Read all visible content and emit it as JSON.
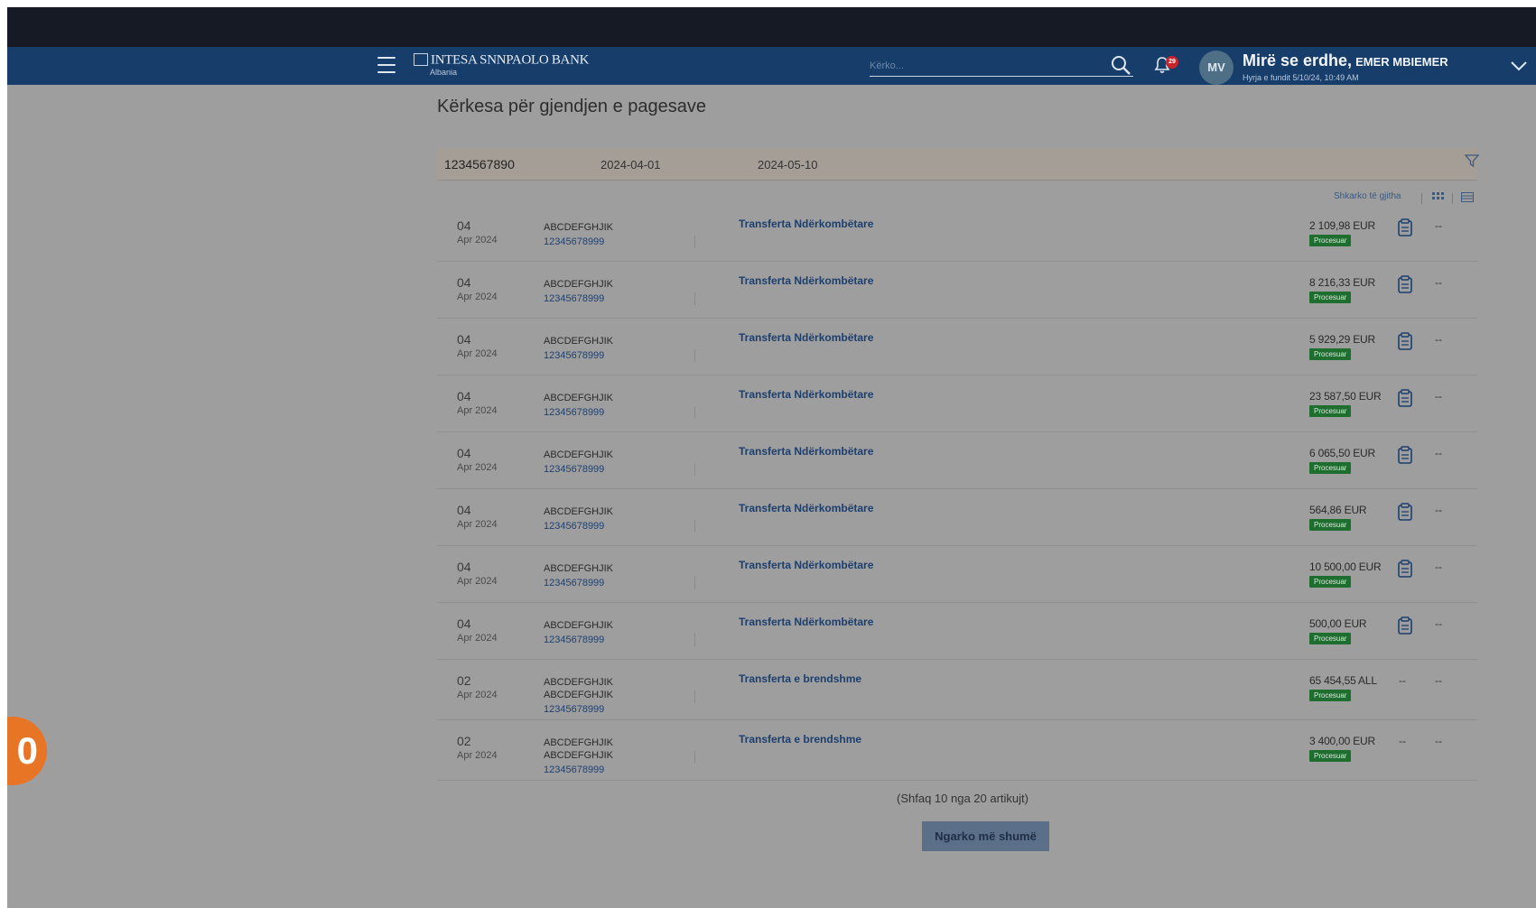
{
  "brand": {
    "name": "INTESA SNNPAOLO BANK",
    "country": "Albania"
  },
  "search": {
    "placeholder": "Kërko..."
  },
  "notifications": {
    "count": "29"
  },
  "user": {
    "initials": "MV",
    "greeting": "Mirë se erdhe,",
    "name": "EMER MBIEMER",
    "last_login": "Hyrja e fundit 5/10/24, 10:49 AM"
  },
  "page": {
    "title": "Kërkesa për gjendjen e pagesave",
    "download_all": "Shkarko të gjitha",
    "pager_info": "(Shfaq 10 nga 20 artikujt)",
    "load_more": "Ngarko më shumë"
  },
  "filter": {
    "account": "1234567890",
    "date_from": "2024-04-01",
    "date_to": "2024-05-10"
  },
  "side_badge": "0",
  "colors": {
    "navbar": "#173d6b",
    "status": "#1d6e2f",
    "badge": "#e87426"
  },
  "payments": [
    {
      "day": "04",
      "month": "Apr 2024",
      "names": [
        "ABCDEFGHJIK"
      ],
      "account": "12345678999",
      "type": "Transferta Ndërkombëtare",
      "amount": "2 109,98 EUR",
      "status": "Procesuar",
      "has_doc": true
    },
    {
      "day": "04",
      "month": "Apr 2024",
      "names": [
        "ABCDEFGHJIK"
      ],
      "account": "12345678999",
      "type": "Transferta Ndërkombëtare",
      "amount": "8 216,33 EUR",
      "status": "Procesuar",
      "has_doc": true
    },
    {
      "day": "04",
      "month": "Apr 2024",
      "names": [
        "ABCDEFGHJIK"
      ],
      "account": "12345678999",
      "type": "Transferta Ndërkombëtare",
      "amount": "5 929,29 EUR",
      "status": "Procesuar",
      "has_doc": true
    },
    {
      "day": "04",
      "month": "Apr 2024",
      "names": [
        "ABCDEFGHJIK"
      ],
      "account": "12345678999",
      "type": "Transferta Ndërkombëtare",
      "amount": "23 587,50 EUR",
      "status": "Procesuar",
      "has_doc": true
    },
    {
      "day": "04",
      "month": "Apr 2024",
      "names": [
        "ABCDEFGHJIK"
      ],
      "account": "12345678999",
      "type": "Transferta Ndërkombëtare",
      "amount": "6 065,50 EUR",
      "status": "Procesuar",
      "has_doc": true
    },
    {
      "day": "04",
      "month": "Apr 2024",
      "names": [
        "ABCDEFGHJIK"
      ],
      "account": "12345678999",
      "type": "Transferta Ndërkombëtare",
      "amount": "564,86 EUR",
      "status": "Procesuar",
      "has_doc": true
    },
    {
      "day": "04",
      "month": "Apr 2024",
      "names": [
        "ABCDEFGHJIK"
      ],
      "account": "12345678999",
      "type": "Transferta Ndërkombëtare",
      "amount": "10 500,00 EUR",
      "status": "Procesuar",
      "has_doc": true
    },
    {
      "day": "04",
      "month": "Apr 2024",
      "names": [
        "ABCDEFGHJIK"
      ],
      "account": "12345678999",
      "type": "Transferta Ndërkombëtare",
      "amount": "500,00 EUR",
      "status": "Procesuar",
      "has_doc": true
    },
    {
      "day": "02",
      "month": "Apr 2024",
      "names": [
        "ABCDEFGHJIK",
        "ABCDEFGHJIK"
      ],
      "account": "12345678999",
      "type": "Transferta e brendshme",
      "amount": "65 454,55 ALL",
      "status": "Procesuar",
      "has_doc": false
    },
    {
      "day": "02",
      "month": "Apr 2024",
      "names": [
        "ABCDEFGHJIK",
        "ABCDEFGHJIK"
      ],
      "account": "12345678999",
      "type": "Transferta e brendshme",
      "amount": "3 400,00 EUR",
      "status": "Procesuar",
      "has_doc": false
    }
  ],
  "dash": "--"
}
